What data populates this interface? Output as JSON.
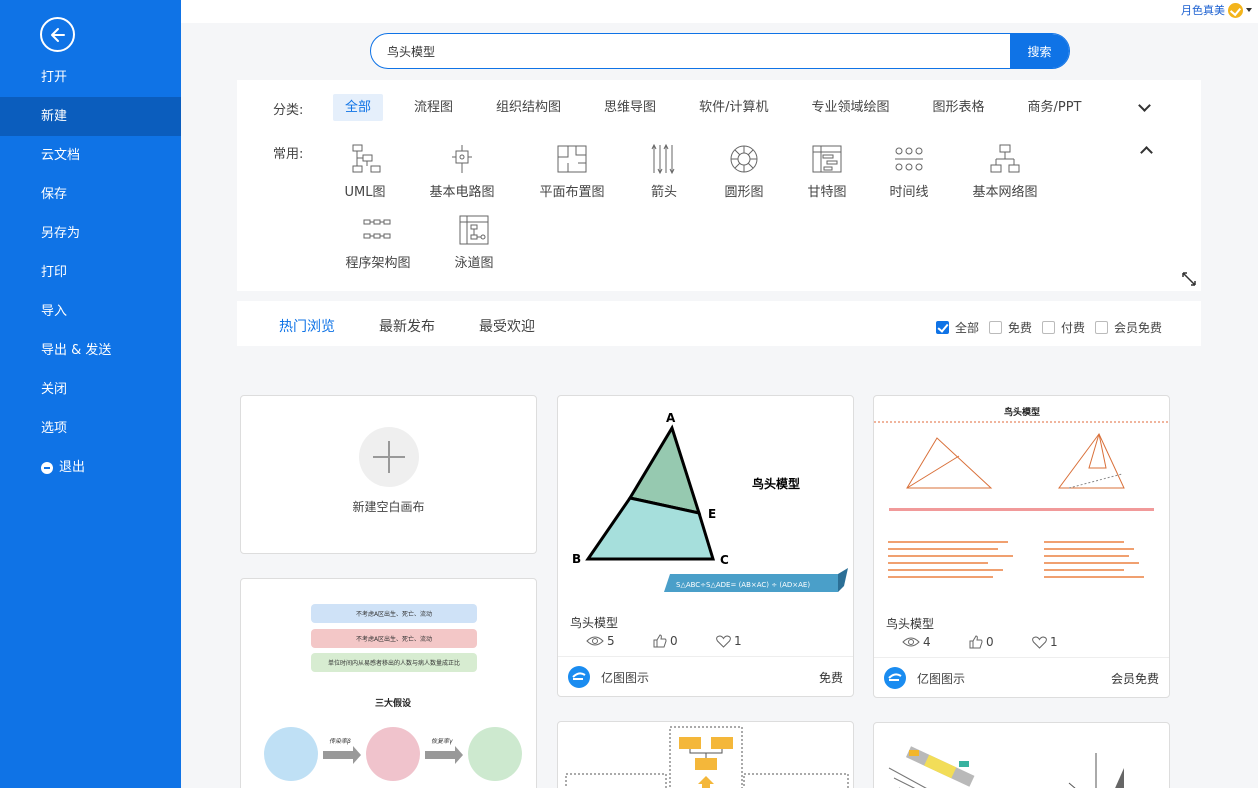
{
  "sidebar": {
    "items": [
      {
        "label": "打开"
      },
      {
        "label": "新建"
      },
      {
        "label": "云文档"
      },
      {
        "label": "保存"
      },
      {
        "label": "另存为"
      },
      {
        "label": "打印"
      },
      {
        "label": "导入"
      },
      {
        "label": "导出 & 发送"
      },
      {
        "label": "关闭"
      },
      {
        "label": "选项"
      },
      {
        "label": "退出"
      }
    ],
    "active_index": 1
  },
  "user": {
    "name": "月色真美"
  },
  "search": {
    "value": "鸟头模型",
    "button_label": "搜索"
  },
  "categories": {
    "label": "分类:",
    "tabs": [
      "全部",
      "流程图",
      "组织结构图",
      "思维导图",
      "软件/计算机",
      "专业领域绘图",
      "图形表格",
      "商务/PPT"
    ],
    "active": "全部"
  },
  "common": {
    "label": "常用:",
    "items": [
      {
        "label": "UML图",
        "icon": "uml-icon"
      },
      {
        "label": "基本电路图",
        "icon": "circuit-icon"
      },
      {
        "label": "平面布置图",
        "icon": "floorplan-icon"
      },
      {
        "label": "箭头",
        "icon": "arrow-icon"
      },
      {
        "label": "圆形图",
        "icon": "circle-chart-icon"
      },
      {
        "label": "甘特图",
        "icon": "gantt-icon"
      },
      {
        "label": "时间线",
        "icon": "timeline-icon"
      },
      {
        "label": "基本网络图",
        "icon": "network-icon"
      },
      {
        "label": "程序架构图",
        "icon": "program-arch-icon"
      },
      {
        "label": "泳道图",
        "icon": "swimlane-icon"
      }
    ]
  },
  "filter": {
    "tabs": [
      "热门浏览",
      "最新发布",
      "最受欢迎"
    ],
    "active": "热门浏览",
    "options": [
      {
        "label": "全部",
        "checked": true
      },
      {
        "label": "免费",
        "checked": false
      },
      {
        "label": "付费",
        "checked": false
      },
      {
        "label": "会员免费",
        "checked": false
      }
    ]
  },
  "blank_canvas": {
    "label": "新建空白画布"
  },
  "templates": [
    {
      "title": "鸟头模型",
      "views": "5",
      "likes": "0",
      "favorites": "1",
      "author": "亿图图示",
      "price": "免费",
      "thumb": {
        "heading": "鸟头模型",
        "points": [
          "A",
          "B",
          "C",
          "E"
        ],
        "formula": "S△ABC÷S△ADE= (AB×AC) ÷ (AD×AE)"
      }
    },
    {
      "title": "鸟头模型",
      "views": "4",
      "likes": "0",
      "favorites": "1",
      "author": "亿图图示",
      "price": "会员免费",
      "thumb": {
        "heading": "鸟头模型"
      }
    }
  ],
  "preview_card": {
    "labels": [
      "不考虑A区出生、死亡、流动",
      "不考虑A区出生、死亡、流动",
      "单位时间内从易感者移出的人数与病人数量成正比"
    ],
    "heading": "三大假设",
    "arrows": [
      "传染率β",
      "恢复率γ"
    ]
  },
  "colors": {
    "primary": "#0f73e6",
    "sidebar_active": "#0b5dbd",
    "accent_gold": "#f3b41b"
  }
}
